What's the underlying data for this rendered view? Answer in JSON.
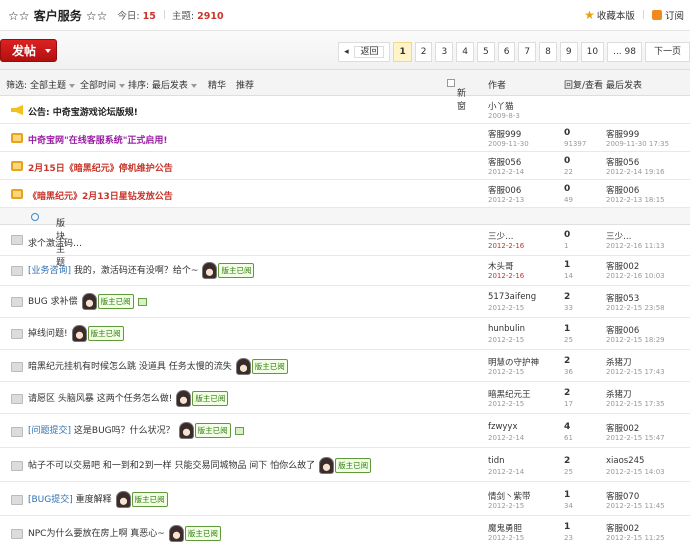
{
  "header": {
    "title": "☆☆ 客户服务 ☆☆",
    "today_label": "今日:",
    "today_value": "15",
    "topics_label": "主题:",
    "topics_value": "2910",
    "favorite": "收藏本版",
    "subscribe": "订阅"
  },
  "toolbar": {
    "post": "发帖",
    "prev": "返回",
    "pages": [
      "1",
      "2",
      "3",
      "4",
      "5",
      "6",
      "7",
      "8",
      "9",
      "10",
      "... 98"
    ],
    "next": "下一页"
  },
  "filters": {
    "filter": "筛选:",
    "all_topics": "全部主题",
    "all_time": "全部时间",
    "sort": "排序: 最后发表",
    "digest": "精华",
    "recommend": "推荐",
    "new_window": "新窗",
    "author": "作者",
    "reply_view": "回复/查看",
    "last_post": "最后发表"
  },
  "section": {
    "label": "版块主题"
  },
  "rows": [
    {
      "title": "公告: 中奇宝游戏论坛版规!",
      "author": "小丫猫",
      "adate": "2009-8-3",
      "replies": "",
      "views": "",
      "last_user": "",
      "last_date": ""
    },
    {
      "title": "中奇宝网\"在线客服系统\"正式启用!",
      "author": "客服999",
      "adate": "2009-11-30",
      "replies": "0",
      "views": "91397",
      "last_user": "客服999",
      "last_date": "2009-11-30 17:35"
    },
    {
      "title": "2月15日《暗黑纪元》停机维护公告",
      "author": "客服056",
      "adate": "2012-2-14",
      "replies": "0",
      "views": "22",
      "last_user": "客服056",
      "last_date": "2012-2-14 19:16"
    },
    {
      "title": "《暗黑纪元》2月13日星钻发放公告",
      "author": "客服006",
      "adate": "2012-2-13",
      "replies": "0",
      "views": "49",
      "last_user": "客服006",
      "last_date": "2012-2-13 18:15"
    },
    {
      "title": "求个激活码…",
      "author": "三少…",
      "adate": "2012-2-16",
      "replies": "0",
      "views": "1",
      "last_user": "三少…",
      "last_date": "2012-2-16 11:13"
    },
    {
      "cat": "[业务咨询]",
      "title": "我的，激活码还有没啊？给个~",
      "tag": "版主已阅",
      "author": "木头哥",
      "adate": "2012-2-16",
      "replies": "1",
      "views": "14",
      "last_user": "客服002",
      "last_date": "2012-2-16 10:03"
    },
    {
      "title": "BUG 求补偿",
      "tag": "版主已阅",
      "author": "5173aifeng",
      "adate": "2012-2-15",
      "replies": "2",
      "views": "33",
      "last_user": "客服053",
      "last_date": "2012-2-15 23:58"
    },
    {
      "title": "掉线问题!",
      "tag": "版主已阅",
      "author": "hunbulin",
      "adate": "2012-2-15",
      "replies": "1",
      "views": "25",
      "last_user": "客服006",
      "last_date": "2012-2-15 18:29"
    },
    {
      "title": "暗黑纪元挂机有时候怎么跳 没道具 任务太慢的流失",
      "tag": "版主已阅",
      "author": "明慧の守护神",
      "adate": "2012-2-15",
      "replies": "2",
      "views": "36",
      "last_user": "杀猪刀",
      "last_date": "2012-2-15 17:43"
    },
    {
      "title": "请愿区 头脑风暴 这两个任务怎么做!",
      "tag": "版主已阅",
      "author": "暗黑纪元王",
      "adate": "2012-2-15",
      "replies": "2",
      "views": "17",
      "last_user": "杀猪刀",
      "last_date": "2012-2-15 17:35"
    },
    {
      "cat": "[问题提交]",
      "title": "这是BUG吗？什么状况？",
      "tag": "版主已阅",
      "author": "fzwyyx",
      "adate": "2012-2-14",
      "replies": "4",
      "views": "61",
      "last_user": "客服002",
      "last_date": "2012-2-15 15:47"
    },
    {
      "title": "帖子不可以交易吧 和一到和2到一样 只能交易同城物品 间下 怕你么故了",
      "tag": "版主已阅",
      "author": "tidn",
      "adate": "2012-2-14",
      "replies": "2",
      "views": "25",
      "last_user": "xiaos245",
      "last_date": "2012-2-15 14:03"
    },
    {
      "cat": "[BUG提交]",
      "title": "重度解释",
      "tag": "版主已阅",
      "author": "情剑丶紫带",
      "adate": "2012-2-15",
      "replies": "1",
      "views": "34",
      "last_user": "客服070",
      "last_date": "2012-2-15 11:45"
    },
    {
      "title": "NPC为什么要放在房上啊 真恶心~",
      "tag": "版主已阅",
      "author": "魔鬼勇胆",
      "adate": "2012-2-15",
      "replies": "1",
      "views": "23",
      "last_user": "客服002",
      "last_date": "2012-2-15 11:25"
    }
  ]
}
